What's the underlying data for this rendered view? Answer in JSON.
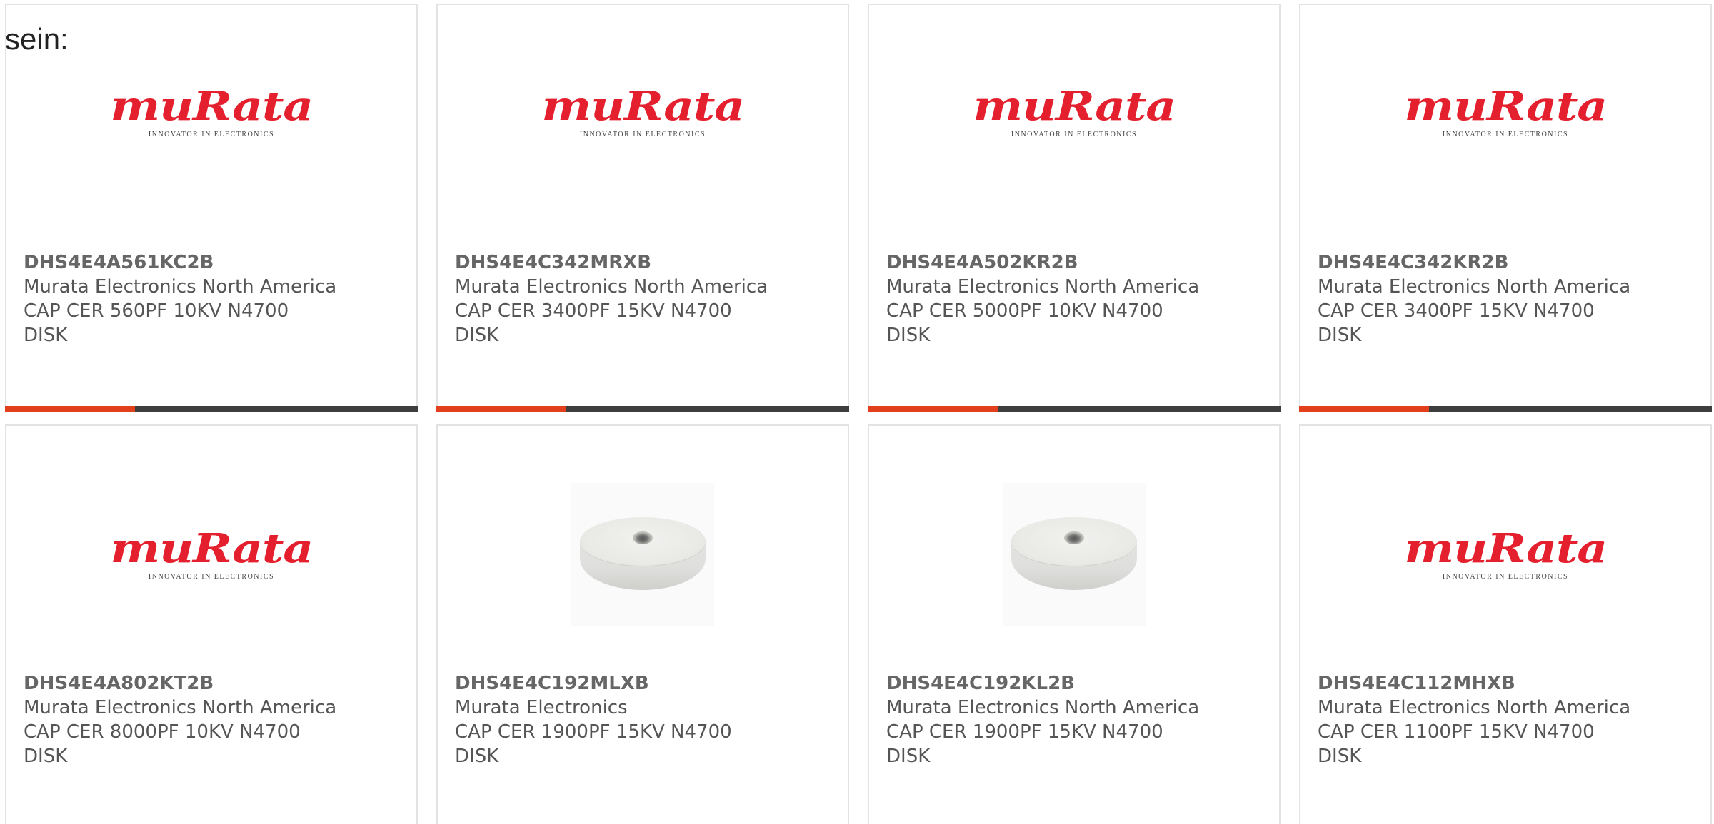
{
  "intro_text": "sein:",
  "logo": {
    "word": "muRata",
    "tagline": "INNOVATOR IN ELECTRONICS"
  },
  "colors": {
    "brand_red": "#e5202e",
    "accent_bar": "#e2401c",
    "bar_dark": "#3e3e3e"
  },
  "products": [
    {
      "part": "DHS4E4A561KC2B",
      "maker": "Murata Electronics North America",
      "desc": "CAP CER 560PF 10KV N4700 DISK",
      "image": "murata-logo"
    },
    {
      "part": "DHS4E4C342MRXB",
      "maker": "Murata Electronics North America",
      "desc": "CAP CER 3400PF 15KV N4700 DISK",
      "image": "murata-logo"
    },
    {
      "part": "DHS4E4A502KR2B",
      "maker": "Murata Electronics North America",
      "desc": "CAP CER 5000PF 10KV N4700 DISK",
      "image": "murata-logo"
    },
    {
      "part": "DHS4E4C342KR2B",
      "maker": "Murata Electronics North America",
      "desc": "CAP CER 3400PF 15KV N4700 DISK",
      "image": "murata-logo"
    },
    {
      "part": "DHS4E4A802KT2B",
      "maker": "Murata Electronics North America",
      "desc": "CAP CER 8000PF 10KV N4700 DISK",
      "image": "murata-logo"
    },
    {
      "part": "DHS4E4C192MLXB",
      "maker": "Murata Electronics",
      "desc": "CAP CER 1900PF 15KV N4700 DISK",
      "image": "disk-capacitor-photo"
    },
    {
      "part": "DHS4E4C192KL2B",
      "maker": "Murata Electronics North America",
      "desc": "CAP CER 1900PF 15KV N4700 DISK",
      "image": "disk-capacitor-photo"
    },
    {
      "part": "DHS4E4C112MHXB",
      "maker": "Murata Electronics North America",
      "desc": "CAP CER 1100PF 15KV N4700 DISK",
      "image": "murata-logo"
    }
  ]
}
